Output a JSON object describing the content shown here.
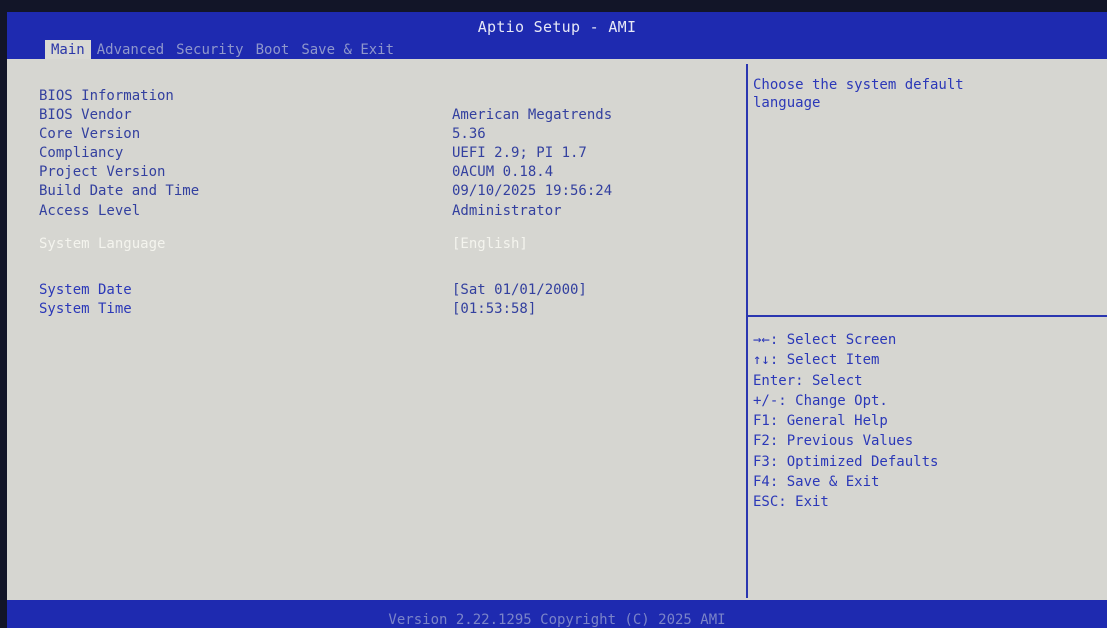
{
  "title": "Aptio Setup - AMI",
  "tabs": [
    {
      "label": "Main",
      "active": true
    },
    {
      "label": "Advanced",
      "active": false
    },
    {
      "label": "Security",
      "active": false
    },
    {
      "label": "Boot",
      "active": false
    },
    {
      "label": "Save & Exit",
      "active": false
    }
  ],
  "main": {
    "bios_info_header": "BIOS Information",
    "bios_vendor": {
      "label": "BIOS Vendor",
      "value": "American Megatrends"
    },
    "core_version": {
      "label": "Core Version",
      "value": "5.36"
    },
    "compliancy": {
      "label": "Compliancy",
      "value": "UEFI 2.9; PI 1.7"
    },
    "project_version": {
      "label": "Project Version",
      "value": "0ACUM 0.18.4"
    },
    "build_date": {
      "label": "Build Date and Time",
      "value": "09/10/2025 19:56:24"
    },
    "access_level": {
      "label": "Access Level",
      "value": "Administrator"
    },
    "system_language": {
      "label": "System Language",
      "value": "[English]"
    },
    "system_date": {
      "label": "System Date",
      "value": "[Sat 01/01/2000]"
    },
    "system_time": {
      "label": "System Time",
      "value": "[01:53:58]"
    }
  },
  "help": {
    "line1": "Choose the system default",
    "line2": "language"
  },
  "keys": [
    "→←: Select Screen",
    "↑↓: Select Item",
    "Enter: Select",
    "+/-: Change Opt.",
    "F1: General Help",
    "F2: Previous Values",
    "F3: Optimized Defaults",
    "F4: Save & Exit",
    "ESC: Exit"
  ],
  "footer": "Version 2.22.1295 Copyright (C) 2025 AMI",
  "colors": {
    "header_bg": "#1e2ab0",
    "panel_bg": "#d6d6d1",
    "text_blue": "#33409f",
    "selected_text": "#f4f4ee"
  }
}
